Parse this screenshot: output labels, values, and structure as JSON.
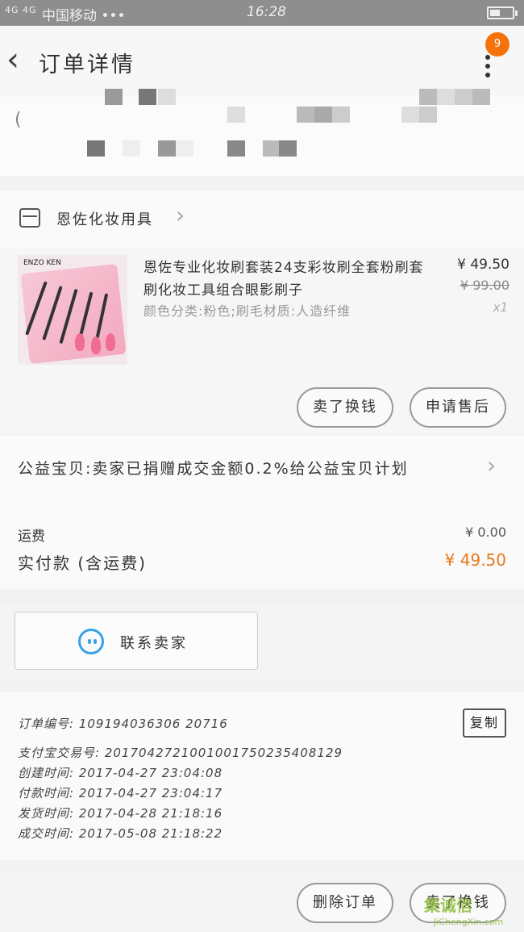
{
  "status_bar": {
    "network": "4G 4G",
    "carrier": "中国移动 •••",
    "time": "16:28"
  },
  "header": {
    "title": "订单详情",
    "badge_count": "9"
  },
  "shop": {
    "name": "恩佐化妆用具"
  },
  "product": {
    "image_brand": "ENZO KEN",
    "title": "恩佐专业化妆刷套装24支彩妆刷全套粉刷套刷化妆工具组合眼影刷子",
    "sku": "颜色分类:粉色;刷毛材质:人造纤维",
    "price": "¥ 49.50",
    "original_price": "¥ 99.00",
    "quantity": "x1",
    "buttons": {
      "buy_again": "卖了换钱",
      "after_sale": "申请售后"
    }
  },
  "charity": {
    "text": "公益宝贝:卖家已捐赠成交金额0.2%给公益宝贝计划"
  },
  "summary": {
    "shipping_label": "运费",
    "shipping_value": "¥ 0.00",
    "paid_label": "实付款 (含运费)",
    "paid_value": "¥ 49.50"
  },
  "contact": {
    "label": "联系卖家"
  },
  "order_info": {
    "order_no": "订单编号: 109194036306 20716",
    "trade_no": "支付宝交易号: 2017042721001001750235408129",
    "created": "创建时间: 2017-04-27 23:04:08",
    "paid": "付款时间: 2017-04-27 23:04:17",
    "shipped": "发货时间: 2017-04-28 21:18:16",
    "completed": "成交时间: 2017-05-08 21:18:22",
    "copy_label": "复制"
  },
  "footer": {
    "delete_label": "删除订单",
    "sell_label": "卖了换钱"
  },
  "watermark": {
    "main": "集诚信",
    "sub": "JiChengXin.com"
  },
  "colors": {
    "accent": "#e8781a",
    "badge": "#f4720c",
    "chat_icon": "#36a3e8"
  }
}
